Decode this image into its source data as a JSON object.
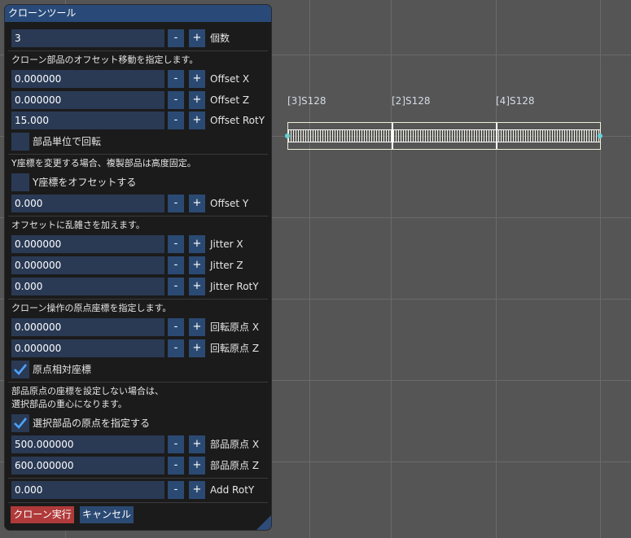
{
  "panel": {
    "title": "クローンツール",
    "count": {
      "value": "3",
      "label": "個数"
    },
    "offset_section": "クローン部品のオフセット移動を指定します。",
    "offset_x": {
      "value": "0.000000",
      "label": "Offset X"
    },
    "offset_z": {
      "value": "0.000000",
      "label": "Offset Z"
    },
    "offset_roty": {
      "value": "15.000",
      "label": "Offset RotY"
    },
    "per_part_rotation": {
      "label": "部品単位で回転",
      "checked": false
    },
    "y_section": "Y座標を変更する場合、複製部品は高度固定。",
    "offset_y_toggle": {
      "label": "Y座標をオフセットする",
      "checked": false
    },
    "offset_y": {
      "value": "0.000",
      "label": "Offset Y"
    },
    "jitter_section": "オフセットに乱雑さを加えます。",
    "jitter_x": {
      "value": "0.000000",
      "label": "Jitter X"
    },
    "jitter_z": {
      "value": "0.000000",
      "label": "Jitter Z"
    },
    "jitter_roty": {
      "value": "0.000",
      "label": "Jitter RotY"
    },
    "origin_section": "クローン操作の原点座標を指定します。",
    "rot_origin_x": {
      "value": "0.000000",
      "label": "回転原点 X"
    },
    "rot_origin_z": {
      "value": "0.000000",
      "label": "回転原点 Z"
    },
    "origin_relative": {
      "label": "原点相対座標",
      "checked": true
    },
    "part_origin_note_1": "部品原点の座標を設定しない場合は、",
    "part_origin_note_2": "選択部品の重心になります。",
    "specify_origin": {
      "label": "選択部品の原点を指定する",
      "checked": true
    },
    "part_origin_x": {
      "value": "500.000000",
      "label": "部品原点 X"
    },
    "part_origin_z": {
      "value": "600.000000",
      "label": "部品原点 Z"
    },
    "add_roty": {
      "value": "0.000",
      "label": "Add RotY"
    },
    "minus": "-",
    "plus": "+",
    "execute_label": "クローン実行",
    "cancel_label": "キャンセル"
  },
  "viewport": {
    "parts": [
      "[3]S128",
      "[2]S128",
      "[4]S128"
    ]
  },
  "colors": {
    "panel_bg": "#1b1b1b",
    "title_bar": "#294a78",
    "field_bg": "#2a3a55",
    "button_bg": "#2b4a73",
    "execute_button": "#b03a3a",
    "cancel_button": "#2b4a73",
    "checkmark": "#4da3ff",
    "viewport_bg": "#555555"
  }
}
